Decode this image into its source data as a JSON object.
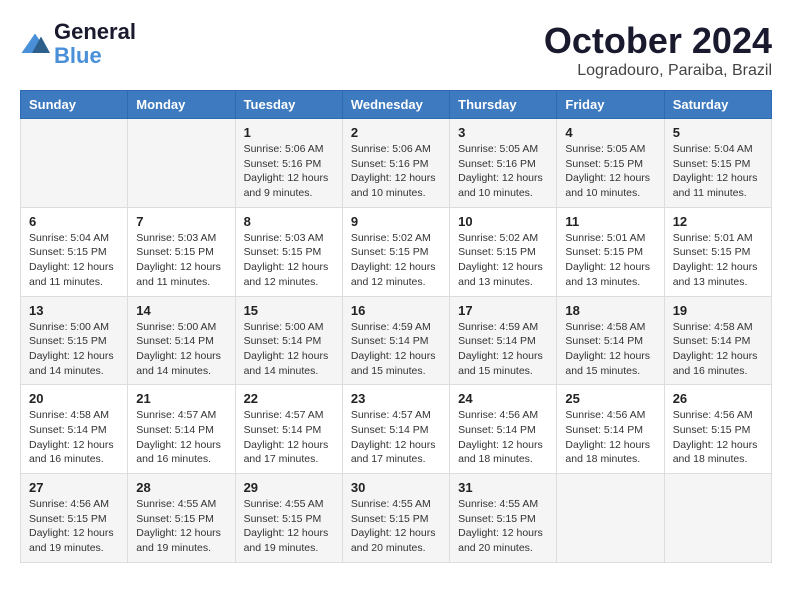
{
  "header": {
    "logo_line1": "General",
    "logo_line2": "Blue",
    "month": "October 2024",
    "location": "Logradouro, Paraiba, Brazil"
  },
  "weekdays": [
    "Sunday",
    "Monday",
    "Tuesday",
    "Wednesday",
    "Thursday",
    "Friday",
    "Saturday"
  ],
  "weeks": [
    [
      {
        "day": "",
        "content": ""
      },
      {
        "day": "",
        "content": ""
      },
      {
        "day": "1",
        "content": "Sunrise: 5:06 AM\nSunset: 5:16 PM\nDaylight: 12 hours and 9 minutes."
      },
      {
        "day": "2",
        "content": "Sunrise: 5:06 AM\nSunset: 5:16 PM\nDaylight: 12 hours and 10 minutes."
      },
      {
        "day": "3",
        "content": "Sunrise: 5:05 AM\nSunset: 5:16 PM\nDaylight: 12 hours and 10 minutes."
      },
      {
        "day": "4",
        "content": "Sunrise: 5:05 AM\nSunset: 5:15 PM\nDaylight: 12 hours and 10 minutes."
      },
      {
        "day": "5",
        "content": "Sunrise: 5:04 AM\nSunset: 5:15 PM\nDaylight: 12 hours and 11 minutes."
      }
    ],
    [
      {
        "day": "6",
        "content": "Sunrise: 5:04 AM\nSunset: 5:15 PM\nDaylight: 12 hours and 11 minutes."
      },
      {
        "day": "7",
        "content": "Sunrise: 5:03 AM\nSunset: 5:15 PM\nDaylight: 12 hours and 11 minutes."
      },
      {
        "day": "8",
        "content": "Sunrise: 5:03 AM\nSunset: 5:15 PM\nDaylight: 12 hours and 12 minutes."
      },
      {
        "day": "9",
        "content": "Sunrise: 5:02 AM\nSunset: 5:15 PM\nDaylight: 12 hours and 12 minutes."
      },
      {
        "day": "10",
        "content": "Sunrise: 5:02 AM\nSunset: 5:15 PM\nDaylight: 12 hours and 13 minutes."
      },
      {
        "day": "11",
        "content": "Sunrise: 5:01 AM\nSunset: 5:15 PM\nDaylight: 12 hours and 13 minutes."
      },
      {
        "day": "12",
        "content": "Sunrise: 5:01 AM\nSunset: 5:15 PM\nDaylight: 12 hours and 13 minutes."
      }
    ],
    [
      {
        "day": "13",
        "content": "Sunrise: 5:00 AM\nSunset: 5:15 PM\nDaylight: 12 hours and 14 minutes."
      },
      {
        "day": "14",
        "content": "Sunrise: 5:00 AM\nSunset: 5:14 PM\nDaylight: 12 hours and 14 minutes."
      },
      {
        "day": "15",
        "content": "Sunrise: 5:00 AM\nSunset: 5:14 PM\nDaylight: 12 hours and 14 minutes."
      },
      {
        "day": "16",
        "content": "Sunrise: 4:59 AM\nSunset: 5:14 PM\nDaylight: 12 hours and 15 minutes."
      },
      {
        "day": "17",
        "content": "Sunrise: 4:59 AM\nSunset: 5:14 PM\nDaylight: 12 hours and 15 minutes."
      },
      {
        "day": "18",
        "content": "Sunrise: 4:58 AM\nSunset: 5:14 PM\nDaylight: 12 hours and 15 minutes."
      },
      {
        "day": "19",
        "content": "Sunrise: 4:58 AM\nSunset: 5:14 PM\nDaylight: 12 hours and 16 minutes."
      }
    ],
    [
      {
        "day": "20",
        "content": "Sunrise: 4:58 AM\nSunset: 5:14 PM\nDaylight: 12 hours and 16 minutes."
      },
      {
        "day": "21",
        "content": "Sunrise: 4:57 AM\nSunset: 5:14 PM\nDaylight: 12 hours and 16 minutes."
      },
      {
        "day": "22",
        "content": "Sunrise: 4:57 AM\nSunset: 5:14 PM\nDaylight: 12 hours and 17 minutes."
      },
      {
        "day": "23",
        "content": "Sunrise: 4:57 AM\nSunset: 5:14 PM\nDaylight: 12 hours and 17 minutes."
      },
      {
        "day": "24",
        "content": "Sunrise: 4:56 AM\nSunset: 5:14 PM\nDaylight: 12 hours and 18 minutes."
      },
      {
        "day": "25",
        "content": "Sunrise: 4:56 AM\nSunset: 5:14 PM\nDaylight: 12 hours and 18 minutes."
      },
      {
        "day": "26",
        "content": "Sunrise: 4:56 AM\nSunset: 5:15 PM\nDaylight: 12 hours and 18 minutes."
      }
    ],
    [
      {
        "day": "27",
        "content": "Sunrise: 4:56 AM\nSunset: 5:15 PM\nDaylight: 12 hours and 19 minutes."
      },
      {
        "day": "28",
        "content": "Sunrise: 4:55 AM\nSunset: 5:15 PM\nDaylight: 12 hours and 19 minutes."
      },
      {
        "day": "29",
        "content": "Sunrise: 4:55 AM\nSunset: 5:15 PM\nDaylight: 12 hours and 19 minutes."
      },
      {
        "day": "30",
        "content": "Sunrise: 4:55 AM\nSunset: 5:15 PM\nDaylight: 12 hours and 20 minutes."
      },
      {
        "day": "31",
        "content": "Sunrise: 4:55 AM\nSunset: 5:15 PM\nDaylight: 12 hours and 20 minutes."
      },
      {
        "day": "",
        "content": ""
      },
      {
        "day": "",
        "content": ""
      }
    ]
  ]
}
